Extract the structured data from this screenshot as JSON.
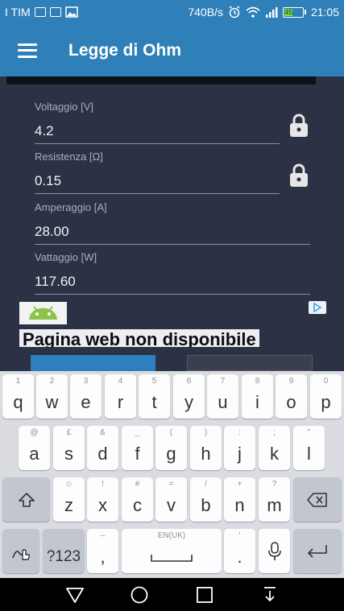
{
  "status": {
    "carrier": "I TIM",
    "net_speed": "740B/s",
    "battery": "45",
    "time": "21:05",
    "icons": [
      "photo-icon",
      "messages-icon",
      "image-icon",
      "alarm-icon",
      "wifi-icon",
      "signal-icon",
      "battery-icon"
    ]
  },
  "appbar": {
    "title": "Legge di Ohm",
    "menu_icon": "hamburger-menu-icon"
  },
  "fields": {
    "voltage": {
      "label": "Voltaggio [V]",
      "value": "4.2"
    },
    "resistance": {
      "label": "Resistenza [Ω]",
      "value": "0.15"
    },
    "current": {
      "label": "Amperaggio [A]",
      "value": "28.00"
    },
    "power": {
      "label": "Vattaggio [W]",
      "value": "117.60"
    }
  },
  "ad": {
    "web_title": "Pagina web non disponibile"
  },
  "keyboard": {
    "row1": [
      {
        "main": "q",
        "sub": "1"
      },
      {
        "main": "w",
        "sub": "2"
      },
      {
        "main": "e",
        "sub": "3"
      },
      {
        "main": "r",
        "sub": "4"
      },
      {
        "main": "t",
        "sub": "5"
      },
      {
        "main": "y",
        "sub": "6"
      },
      {
        "main": "u",
        "sub": "7"
      },
      {
        "main": "i",
        "sub": "8"
      },
      {
        "main": "o",
        "sub": "9"
      },
      {
        "main": "p",
        "sub": "0"
      }
    ],
    "row2": [
      {
        "main": "a",
        "sub": "@"
      },
      {
        "main": "s",
        "sub": "£"
      },
      {
        "main": "d",
        "sub": "&"
      },
      {
        "main": "f",
        "sub": "_"
      },
      {
        "main": "g",
        "sub": "("
      },
      {
        "main": "h",
        "sub": ")"
      },
      {
        "main": "j",
        "sub": ":"
      },
      {
        "main": "k",
        "sub": ";"
      },
      {
        "main": "l",
        "sub": "\""
      }
    ],
    "row3": [
      {
        "main": "z",
        "sub": "☺"
      },
      {
        "main": "x",
        "sub": "!"
      },
      {
        "main": "c",
        "sub": "#"
      },
      {
        "main": "v",
        "sub": "="
      },
      {
        "main": "b",
        "sub": "/"
      },
      {
        "main": "n",
        "sub": "+"
      },
      {
        "main": "m",
        "sub": "?"
      }
    ],
    "symbols_label": "?123",
    "comma": {
      "main": ",",
      "sub": "–"
    },
    "space_label": "EN(UK)",
    "period": {
      "main": ".",
      "sub": "'"
    }
  }
}
